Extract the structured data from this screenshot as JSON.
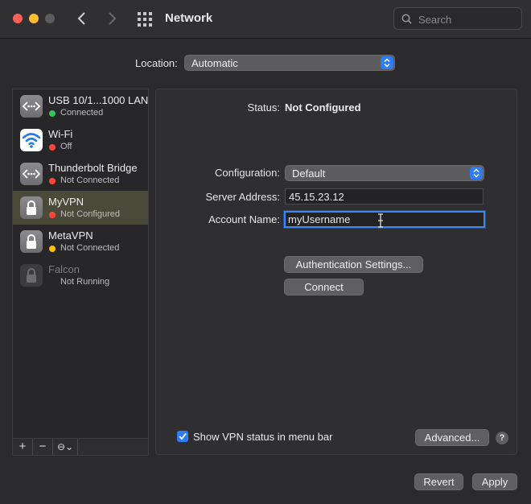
{
  "window": {
    "title": "Network"
  },
  "search": {
    "placeholder": "Search"
  },
  "location": {
    "label": "Location:",
    "value": "Automatic"
  },
  "services": [
    {
      "name": "USB 10/1...1000 LAN",
      "status": "Connected",
      "status_color": "#32c759",
      "icon": "ethernet-icon"
    },
    {
      "name": "Wi-Fi",
      "status": "Off",
      "status_color": "#ff453a",
      "icon": "wifi-icon"
    },
    {
      "name": "Thunderbolt Bridge",
      "status": "Not Connected",
      "status_color": "#ff453a",
      "icon": "ethernet-icon"
    },
    {
      "name": "MyVPN",
      "status": "Not Configured",
      "status_color": "#ff453a",
      "icon": "lock-icon",
      "selected": true
    },
    {
      "name": "MetaVPN",
      "status": "Not Connected",
      "status_color": "#ffc400",
      "icon": "lock-icon"
    },
    {
      "name": "Falcon",
      "status": "Not Running",
      "icon": "lock-icon",
      "disabled": true
    }
  ],
  "sidebar_tools": {
    "add": "+",
    "remove": "−",
    "action": "⊖⌄"
  },
  "detail": {
    "status_label": "Status:",
    "status_value": "Not Configured",
    "configuration_label": "Configuration:",
    "configuration_value": "Default",
    "server_label": "Server Address:",
    "server_value": "45.15.23.12",
    "account_label": "Account Name:",
    "account_value": "myUsername",
    "auth_button": "Authentication Settings...",
    "connect_button": "Connect",
    "show_status_label": "Show VPN status in menu bar",
    "show_status_checked": true,
    "advanced_button": "Advanced...",
    "help": "?"
  },
  "footer": {
    "revert": "Revert",
    "apply": "Apply"
  },
  "colors": {
    "accent": "#2f7df6",
    "background": "#2b2a2d"
  }
}
